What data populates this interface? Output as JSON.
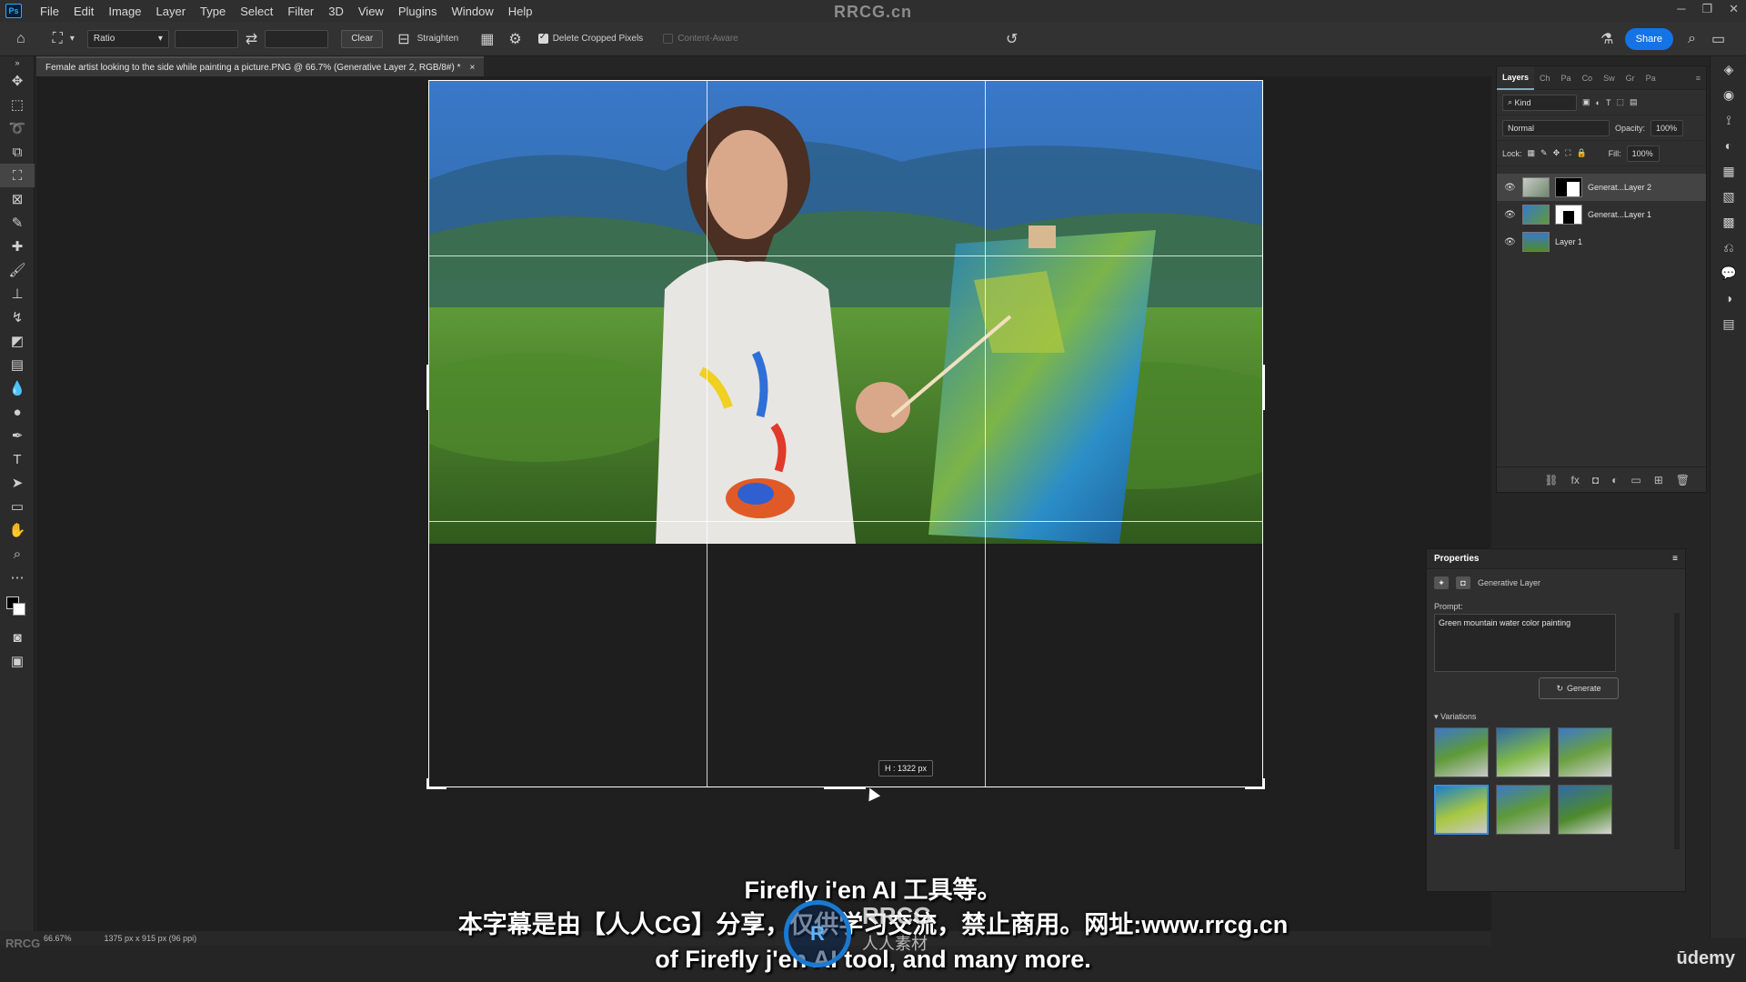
{
  "app": {
    "logo_text": "Ps",
    "watermark_title": "RRCG.cn",
    "menu": [
      "File",
      "Edit",
      "Image",
      "Layer",
      "Type",
      "Select",
      "Filter",
      "3D",
      "View",
      "Plugins",
      "Window",
      "Help"
    ]
  },
  "options_bar": {
    "ratio_select": "Ratio",
    "clear_label": "Clear",
    "straighten_label": "Straighten",
    "delete_cropped_label": "Delete Cropped Pixels",
    "delete_cropped_checked": true,
    "content_aware_label": "Content-Aware",
    "content_aware_checked": false,
    "share_label": "Share"
  },
  "document": {
    "tab_title": "Female artist looking to the side while painting a picture.PNG @ 66.7% (Generative Layer 2, RGB/8#) *",
    "tab_close": "×",
    "crop_dimension": "H :  1322 px"
  },
  "status_bar": {
    "zoom": "66.67%",
    "doc_info": "1375 px x 915 px (96 ppi)"
  },
  "layers_panel": {
    "tabs": [
      "Layers",
      "Ch",
      "Pa",
      "Co",
      "Sw",
      "Gr",
      "Pa"
    ],
    "active_tab": "Layers",
    "filter_kind": "Kind",
    "blend_mode": "Normal",
    "opacity_label": "Opacity:",
    "opacity_value": "100%",
    "lock_label": "Lock:",
    "fill_label": "Fill:",
    "fill_value": "100%",
    "layers": [
      {
        "name": "Generat...Layer 2",
        "selected": true
      },
      {
        "name": "Generat...Layer 1",
        "selected": false
      },
      {
        "name": "Layer 1",
        "selected": false
      }
    ]
  },
  "properties_panel": {
    "title": "Properties",
    "layer_type": "Generative Layer",
    "prompt_label": "Prompt:",
    "prompt_value": "Green mountain water color painting",
    "generate_label": "Generate",
    "variations_label": "Variations",
    "variations_count": 6,
    "selected_variation": 3
  },
  "subtitles": {
    "line1": "Firefly i'en AI 工具等。",
    "line2": "本字幕是由【人人CG】分享，仅供学习交流，禁止商用。网址:www.rrcg.cn",
    "line3": "of Firefly j'en AI tool, and many more."
  },
  "branding": {
    "udemy": "ūdemy",
    "rrcg_logo_text": "RRCG",
    "rrcg_logo_sub": "人人素材",
    "corner_logo": "RRCG"
  }
}
